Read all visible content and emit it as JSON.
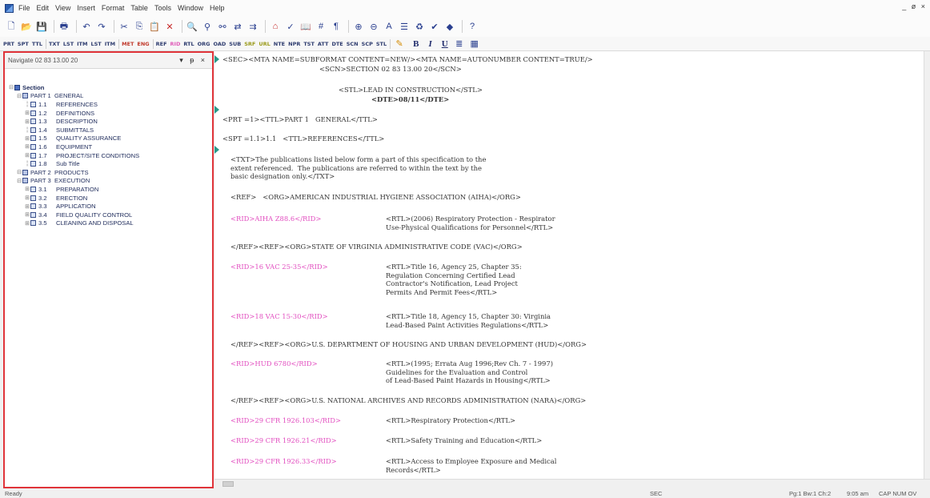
{
  "menubar": {
    "items": [
      "File",
      "Edit",
      "View",
      "Insert",
      "Format",
      "Table",
      "Tools",
      "Window",
      "Help"
    ],
    "window_controls": "_ ø ×"
  },
  "toolbar": {
    "icons": [
      "new-file-icon",
      "open-folder-icon",
      "save-icon",
      "print-icon",
      "undo-icon",
      "redo-icon",
      "cut-icon",
      "copy-icon",
      "paste-icon",
      "delete-icon",
      "find-icon",
      "find-next-icon",
      "find-replace-icon",
      "replace-icon",
      "replace-all-icon",
      "tag-icon",
      "spell-check-icon",
      "thesaurus-icon",
      "word-count-icon",
      "paragraph-icon",
      "zoom-in-icon",
      "zoom-out-icon",
      "font-size-icon",
      "align-icon",
      "validate-icon",
      "check-icon",
      "bookmark-icon",
      "help-icon"
    ]
  },
  "tag_toolbar": {
    "group1": [
      "PRT",
      "SPT",
      "TTL"
    ],
    "group2": [
      "TXT",
      "LST",
      "ITM",
      "LST",
      "ITM"
    ],
    "group3": [
      "MET",
      "ENG"
    ],
    "group4": [
      "REF",
      "RID",
      "RTL",
      "ORG",
      "OAD",
      "SUB",
      "SRF",
      "URL",
      "NTE",
      "NPR",
      "TST",
      "ATT",
      "DTE",
      "SCN",
      "SCP",
      "STL"
    ],
    "pink_tags": [
      "RID"
    ],
    "olive_tags": [
      "SRF",
      "URL"
    ],
    "red_tags": [
      "MET",
      "ENG"
    ],
    "format": [
      "B",
      "I",
      "U"
    ]
  },
  "navigator": {
    "title": "Navigate 02 83 13.00 20",
    "controls": "▾ ᵽ ×",
    "tree": [
      {
        "level": 0,
        "type": "sec",
        "num": "",
        "label": "Section",
        "bold": true
      },
      {
        "level": 1,
        "type": "part",
        "num": "PART 1",
        "label": "GENERAL"
      },
      {
        "level": 2,
        "type": "item",
        "num": "1.1",
        "label": "REFERENCES"
      },
      {
        "level": 2,
        "type": "item",
        "num": "1.2",
        "label": "DEFINITIONS"
      },
      {
        "level": 2,
        "type": "item",
        "num": "1.3",
        "label": "DESCRIPTION"
      },
      {
        "level": 2,
        "type": "item",
        "num": "1.4",
        "label": "SUBMITTALS"
      },
      {
        "level": 2,
        "type": "item",
        "num": "1.5",
        "label": "QUALITY ASSURANCE"
      },
      {
        "level": 2,
        "type": "item",
        "num": "1.6",
        "label": "EQUIPMENT"
      },
      {
        "level": 2,
        "type": "item",
        "num": "1.7",
        "label": "PROJECT/SITE CONDITIONS"
      },
      {
        "level": 2,
        "type": "item",
        "num": "1.8",
        "label": "Sub Title"
      },
      {
        "level": 1,
        "type": "part",
        "num": "PART 2",
        "label": "PRODUCTS"
      },
      {
        "level": 1,
        "type": "part",
        "num": "PART 3",
        "label": "EXECUTION"
      },
      {
        "level": 2,
        "type": "item",
        "num": "3.1",
        "label": "PREPARATION"
      },
      {
        "level": 2,
        "type": "item",
        "num": "3.2",
        "label": "ERECTION"
      },
      {
        "level": 2,
        "type": "item",
        "num": "3.3",
        "label": "APPLICATION"
      },
      {
        "level": 2,
        "type": "item",
        "num": "3.4",
        "label": "FIELD QUALITY CONTROL"
      },
      {
        "level": 2,
        "type": "item",
        "num": "3.5",
        "label": "CLEANING AND DISPOSAL"
      }
    ]
  },
  "editor": {
    "l01": "<SEC><MTA NAME=SUBFORMAT CONTENT=NEW/><MTA NAME=AUTONUMBER CONTENT=TRUE/>",
    "l02": "<SCN>SECTION 02 83 13.00 20</SCN>",
    "l03": "<STL>LEAD IN CONSTRUCTION</STL>",
    "l04": "<DTE>08/11</DTE>",
    "l05": "<PRT =1><TTL>PART 1   GENERAL</TTL>",
    "l06": "<SPT =1.1>1.1   <TTL>REFERENCES</TTL>",
    "l07": "<TXT>The publications listed below form a part of this specification to the\nextent referenced.  The publications are referred to within the text by the\nbasic designation only.</TXT>",
    "l08": "<REF>   <ORG>AMERICAN INDUSTRIAL HYGIENE ASSOCIATION (AIHA)</ORG>",
    "r1_id": "<RID>AIHA Z88.6</RID>",
    "r1_tl": "<RTL>(2006) Respiratory Protection - Respirator\nUse-Physical Qualifications for Personnel</RTL>",
    "l09": "</REF><REF><ORG>STATE OF VIRGINIA ADMINISTRATIVE CODE (VAC)</ORG>",
    "r2_id": "<RID>16 VAC 25-35</RID>",
    "r2_tl": "<RTL>Title 16, Agency 25, Chapter 35:\nRegulation Concerning Certified Lead\nContractor's Notification, Lead Project\nPermits And Permit Fees</RTL>",
    "r3_id": "<RID>18 VAC 15-30</RID>",
    "r3_tl": "<RTL>Title 18, Agency 15, Chapter 30: Virginia\nLead-Based Paint Activities Regulations</RTL>",
    "l10": "</REF><REF><ORG>U.S. DEPARTMENT OF HOUSING AND URBAN DEVELOPMENT (HUD)</ORG>",
    "r4_id": "<RID>HUD 6780</RID>",
    "r4_tl": "<RTL>(1995; Errata Aug 1996;Rev Ch. 7 - 1997)\nGuidelines for the Evaluation and Control\nof Lead-Based Paint Hazards in Housing</RTL>",
    "l11": "</REF><REF><ORG>U.S. NATIONAL ARCHIVES AND RECORDS ADMINISTRATION (NARA)</ORG>",
    "r5_id": "<RID>29 CFR 1926.103</RID>",
    "r5_tl": "<RTL>Respiratory Protection</RTL>",
    "r6_id": "<RID>29 CFR 1926.21</RID>",
    "r6_tl": "<RTL>Safety Training and Education</RTL>",
    "r7_id": "<RID>29 CFR 1926.33</RID>",
    "r7_tl": "<RTL>Access to Employee Exposure and Medical\nRecords</RTL>"
  },
  "status": {
    "left": "Ready",
    "tag": "SEC",
    "position": "Pg:1 Bw:1 Ch:2",
    "time": "9:05 am",
    "modes": "CAP NUM OV"
  }
}
